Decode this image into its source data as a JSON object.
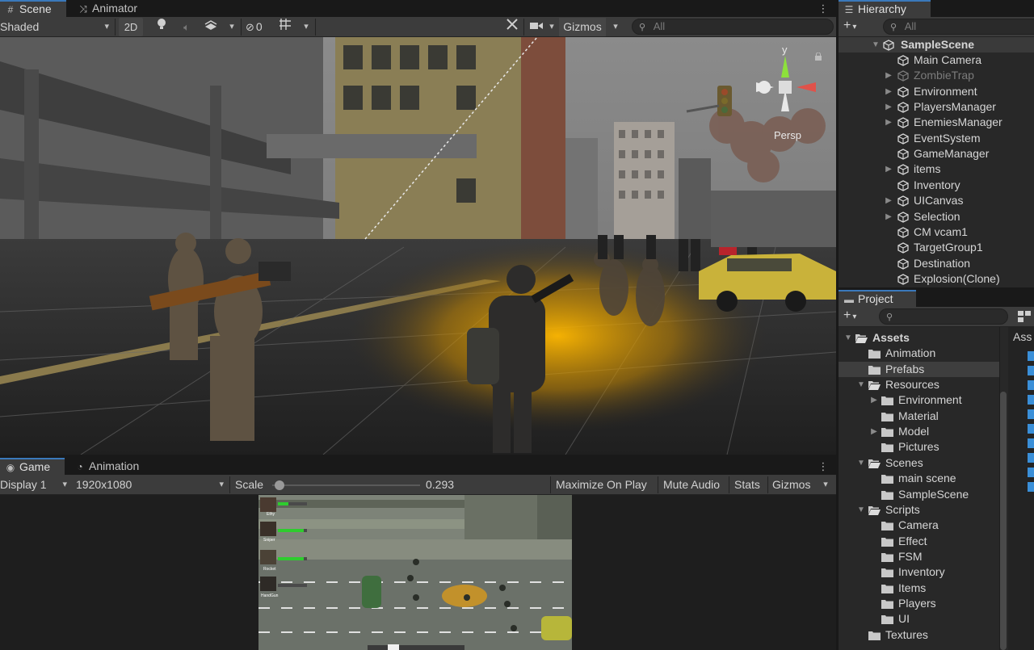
{
  "scene_panel": {
    "tabs": [
      {
        "label": "Scene",
        "icon": "grid-icon"
      },
      {
        "label": "Animator",
        "icon": "animator-icon"
      }
    ],
    "toolbar": {
      "shading_mode": "Shaded",
      "two_d_label": "2D",
      "hidden_count": "0",
      "gizmos_label": "Gizmos",
      "search_placeholder": "All"
    },
    "orientation_gizmo": {
      "axis_y": "y",
      "projection_label": "Persp"
    }
  },
  "game_panel": {
    "tabs": [
      {
        "label": "Game",
        "icon": "gamepad-icon"
      },
      {
        "label": "Animation",
        "icon": "clock-icon"
      }
    ],
    "toolbar": {
      "display": "Display 1",
      "resolution": "1920x1080",
      "scale_label": "Scale",
      "scale_value": "0.293",
      "scale_fraction": 0.02,
      "maximize_on_play": "Maximize On Play",
      "mute_audio": "Mute Audio",
      "stats": "Stats",
      "gizmos": "Gizmos"
    },
    "hud_characters": [
      {
        "name": "Ethy",
        "health": 0.35
      },
      {
        "name": "Sniper",
        "health": 0.9
      },
      {
        "name": "Rocket",
        "health": 0.9
      },
      {
        "name": "HandGun",
        "health": 0.0
      }
    ]
  },
  "hierarchy": {
    "tab_label": "Hierarchy",
    "search_placeholder": "All",
    "scene_name": "SampleScene",
    "items": [
      {
        "label": "Main Camera",
        "expandable": false,
        "dim": false
      },
      {
        "label": "ZombieTrap",
        "expandable": true,
        "dim": true
      },
      {
        "label": "Environment",
        "expandable": true,
        "dim": false
      },
      {
        "label": "PlayersManager",
        "expandable": true,
        "dim": false
      },
      {
        "label": "EnemiesManager",
        "expandable": true,
        "dim": false
      },
      {
        "label": "EventSystem",
        "expandable": false,
        "dim": false
      },
      {
        "label": "GameManager",
        "expandable": false,
        "dim": false
      },
      {
        "label": "items",
        "expandable": true,
        "dim": false
      },
      {
        "label": "Inventory",
        "expandable": false,
        "dim": false
      },
      {
        "label": "UICanvas",
        "expandable": true,
        "dim": false
      },
      {
        "label": "Selection",
        "expandable": true,
        "dim": false
      },
      {
        "label": "CM vcam1",
        "expandable": false,
        "dim": false
      },
      {
        "label": "TargetGroup1",
        "expandable": false,
        "dim": false
      },
      {
        "label": "Destination",
        "expandable": false,
        "dim": false
      },
      {
        "label": "Explosion(Clone)",
        "expandable": false,
        "dim": false
      }
    ]
  },
  "project": {
    "tab_label": "Project",
    "right_header": "Ass",
    "folders": [
      {
        "label": "Assets",
        "depth": 0,
        "caret": "open",
        "bold": true
      },
      {
        "label": "Animation",
        "depth": 1,
        "caret": "none"
      },
      {
        "label": "Prefabs",
        "depth": 1,
        "caret": "none",
        "selected": true
      },
      {
        "label": "Resources",
        "depth": 1,
        "caret": "open"
      },
      {
        "label": "Environment",
        "depth": 2,
        "caret": "closed"
      },
      {
        "label": "Material",
        "depth": 2,
        "caret": "none"
      },
      {
        "label": "Model",
        "depth": 2,
        "caret": "closed"
      },
      {
        "label": "Pictures",
        "depth": 2,
        "caret": "none"
      },
      {
        "label": "Scenes",
        "depth": 1,
        "caret": "open"
      },
      {
        "label": "main scene",
        "depth": 2,
        "caret": "none"
      },
      {
        "label": "SampleScene",
        "depth": 2,
        "caret": "none"
      },
      {
        "label": "Scripts",
        "depth": 1,
        "caret": "open"
      },
      {
        "label": "Camera",
        "depth": 2,
        "caret": "none"
      },
      {
        "label": "Effect",
        "depth": 2,
        "caret": "none"
      },
      {
        "label": "FSM",
        "depth": 2,
        "caret": "none"
      },
      {
        "label": "Inventory",
        "depth": 2,
        "caret": "none"
      },
      {
        "label": "Items",
        "depth": 2,
        "caret": "none"
      },
      {
        "label": "Players",
        "depth": 2,
        "caret": "none"
      },
      {
        "label": "UI",
        "depth": 2,
        "caret": "none"
      },
      {
        "label": "Textures",
        "depth": 1,
        "caret": "none"
      }
    ]
  },
  "colors": {
    "accent": "#3a79bb",
    "panel": "#282828",
    "toolbar": "#3c3c3c",
    "health_green": "#2ecc2e",
    "light_glow": "#f0a800"
  }
}
